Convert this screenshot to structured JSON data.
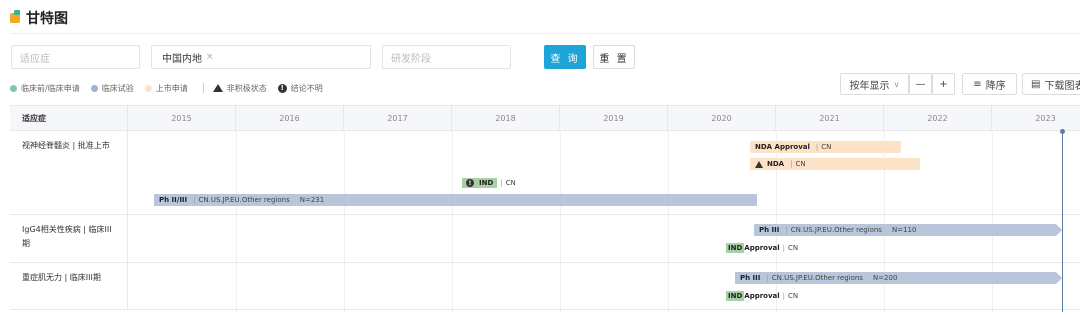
{
  "header": {
    "title": "甘特图"
  },
  "filters": {
    "indication_placeholder": "适应症",
    "region_tag": "中国内地",
    "region_tag_close": "×",
    "stage_placeholder": "研发阶段",
    "query_label": "查 询",
    "reset_label": "重 置"
  },
  "legend": {
    "items": [
      {
        "label": "临床前/临床申请",
        "color": "#7ec9a4"
      },
      {
        "label": "临床试验",
        "color": "#9db3d1"
      },
      {
        "label": "上市申请",
        "color": "#fce2c6"
      }
    ],
    "inactive_label": "非积极状态",
    "unclear_label": "结论不明"
  },
  "toolbar": {
    "view_mode": "按年显示",
    "zoom_out": "—",
    "zoom_in": "+",
    "sort_label": "降序",
    "download_label": "下载图表"
  },
  "grid": {
    "indication_header": "适应症",
    "years": [
      "2015",
      "2016",
      "2017",
      "2018",
      "2019",
      "2020",
      "2021",
      "2022",
      "2023"
    ]
  },
  "rows": [
    {
      "label": "视神经脊髓炎 | 批准上市",
      "bars": [
        {
          "type": "peach",
          "title": "NDA Approval",
          "region": "CN"
        },
        {
          "type": "peach",
          "title": "NDA",
          "region": "CN",
          "inactive": true
        },
        {
          "type": "plain",
          "title": "IND",
          "region": "CN",
          "unclear": true
        },
        {
          "type": "blue",
          "title": "Ph II/III",
          "region": "CN.US.JP.EU.Other regions",
          "n": "N=231"
        }
      ]
    },
    {
      "label": "IgG4相关性疾病 | 临床III期",
      "bars": [
        {
          "type": "blue",
          "title": "Ph III",
          "region": "CN.US.JP.EU.Other regions",
          "n": "N=110"
        },
        {
          "type": "plain",
          "title": "IND",
          "suffix": "Approval",
          "region": "CN"
        }
      ]
    },
    {
      "label": "重症肌无力 | 临床III期",
      "bars": [
        {
          "type": "blue",
          "title": "Ph III",
          "region": "CN.US.JP.EU.Other regions",
          "n": "N=200"
        },
        {
          "type": "plain",
          "title": "IND",
          "suffix": "Approval",
          "region": "CN"
        }
      ]
    }
  ]
}
